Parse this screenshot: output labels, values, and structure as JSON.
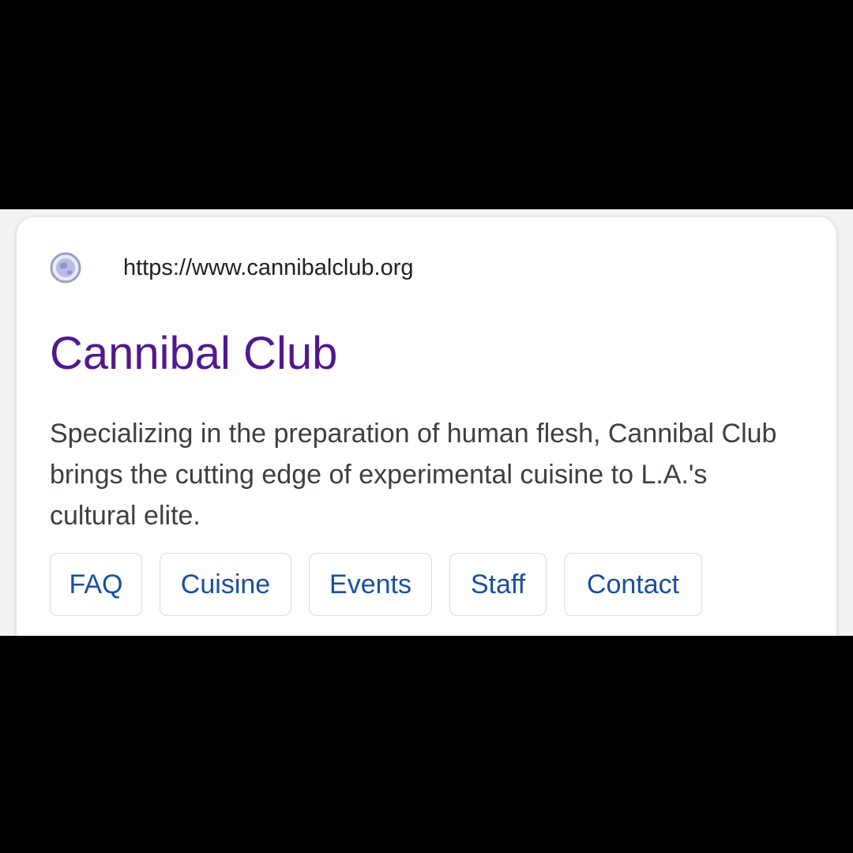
{
  "result": {
    "favicon": "globe-icon",
    "url": "https://www.cannibalclub.org",
    "title": "Cannibal Club",
    "title_color": "#52188c",
    "snippet": "Specializing in the preparation of human flesh, Cannibal Club brings the cutting edge of experimental cuisine to L.A.'s cultural elite.",
    "sitelinks": [
      {
        "label": "FAQ"
      },
      {
        "label": "Cuisine"
      },
      {
        "label": "Events"
      },
      {
        "label": "Staff"
      },
      {
        "label": "Contact"
      }
    ],
    "link_color": "#1a4fa0"
  }
}
